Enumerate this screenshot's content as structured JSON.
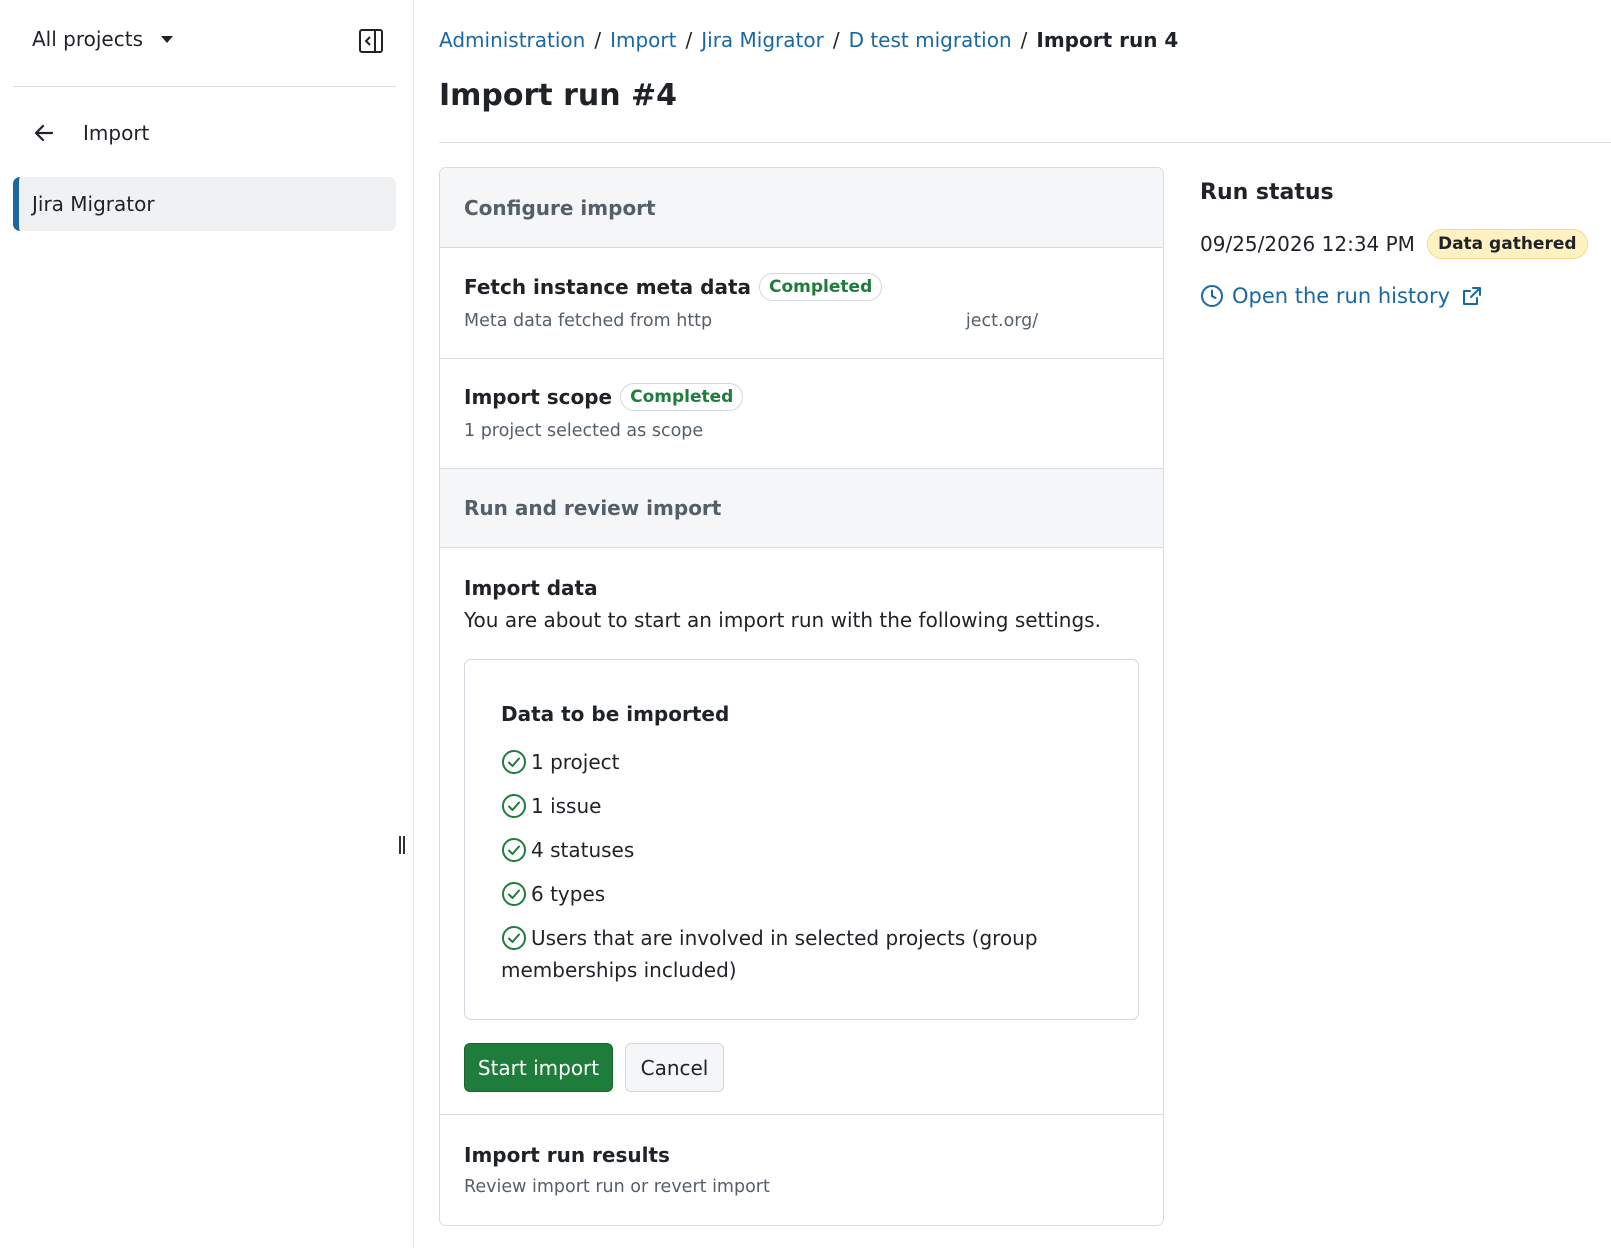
{
  "sidebar": {
    "project_selector": "All projects",
    "back_label": "Import",
    "items": [
      {
        "label": "Jira Migrator",
        "selected": true
      }
    ]
  },
  "breadcrumb": {
    "items": [
      "Administration",
      "Import",
      "Jira Migrator",
      "D test migration"
    ],
    "current": "Import run 4"
  },
  "page": {
    "title": "Import run #4"
  },
  "configure": {
    "heading": "Configure import",
    "steps": [
      {
        "title": "Fetch instance meta data",
        "status": "Completed",
        "subtitle": "Meta data fetched from http                             ject.org/"
      },
      {
        "title": "Import scope",
        "status": "Completed",
        "subtitle": "1 project selected as scope"
      }
    ]
  },
  "run_review": {
    "heading": "Run and review import",
    "import_data": {
      "title": "Import data",
      "description": "You are about to start an import run with the following settings.",
      "summary_title": "Data to be imported",
      "items": [
        "1 project",
        "1 issue",
        "4 statuses",
        "6 types",
        "Users that are involved in selected projects (group memberships included)"
      ]
    },
    "buttons": {
      "start": "Start import",
      "cancel": "Cancel"
    },
    "results": {
      "title": "Import run results",
      "subtitle": "Review import run or revert import"
    }
  },
  "run_status": {
    "title": "Run status",
    "timestamp": "09/25/2026 12:34 PM",
    "badge": "Data gathered",
    "history_link": "Open the run history"
  },
  "colors": {
    "link": "#1a67a3",
    "success": "#1e7d3a",
    "attention_bg": "#fff1c2",
    "sidebar_accent": "#1a67a3"
  },
  "icons": {
    "back": "arrow-left-icon",
    "collapse": "sidebar-collapse-icon",
    "check": "check-circle-icon",
    "history": "clock-icon",
    "external": "external-link-icon"
  }
}
